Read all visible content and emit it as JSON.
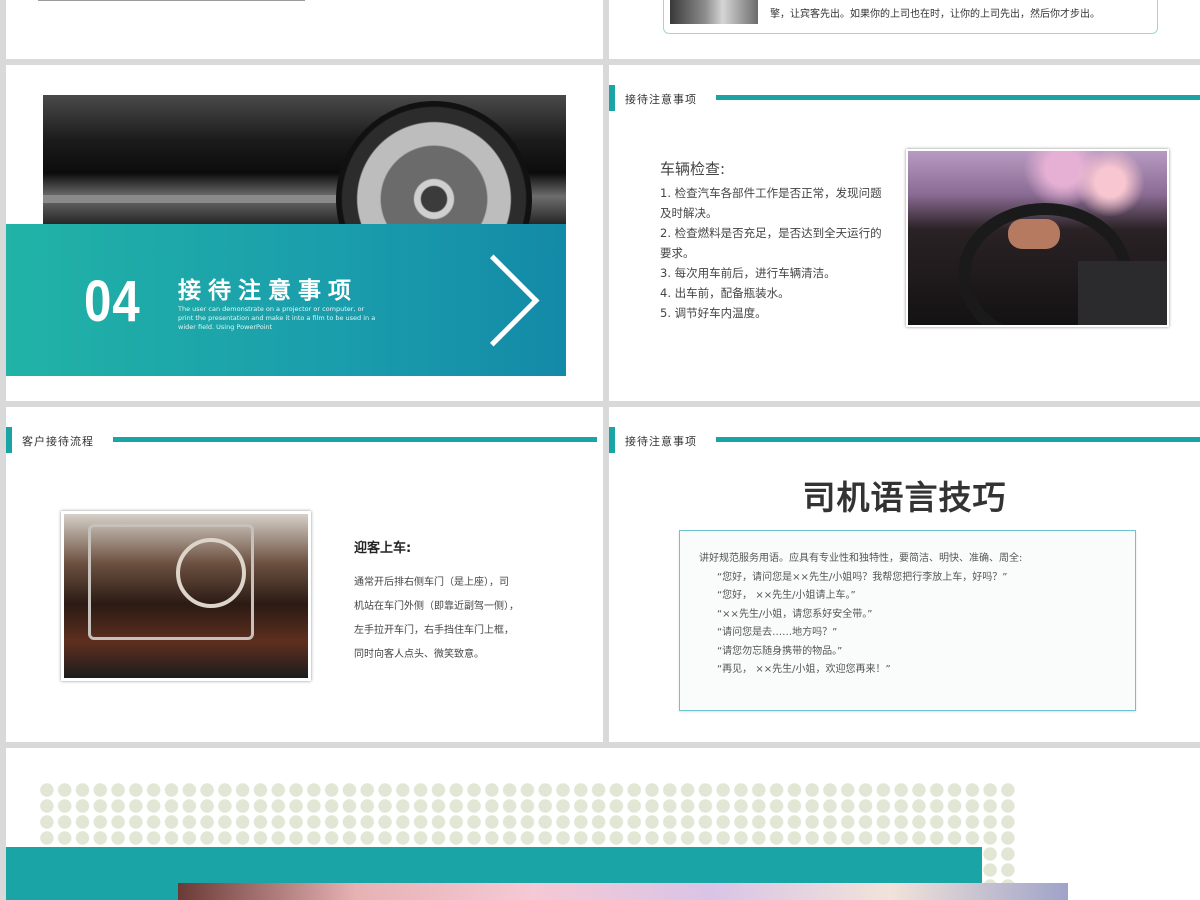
{
  "top_right_fragment": {
    "text": "擎，让宾客先出。如果你的上司也在时，让你的上司先出，然后你才步出。"
  },
  "section_intro": {
    "number": "04",
    "title": "接待注意事项",
    "subtitle": "The user can demonstrate on a projector or computer, or print the presentation and make it into a film to be used in a wider field. Using PowerPoint"
  },
  "vehicle_check": {
    "header": "接待注意事项",
    "title": "车辆检查:",
    "items": [
      "1. 检查汽车各部件工作是否正常，发现问题及时解决。",
      " 2. 检查燃料是否充足，是否达到全天运行的要求。",
      " 3. 每次用车前后，进行车辆清洁。",
      " 4. 出车前，配备瓶装水。",
      " 5. 调节好车内温度。"
    ]
  },
  "welcome": {
    "header": "客户接待流程",
    "title": "迎客上车:",
    "lines": [
      "通常开后排右侧车门（是上座），司",
      "机站在车门外侧（即靠近副驾一侧），",
      "左手拉开车门，右手挡住车门上框，",
      "同时向客人点头、微笑致意。"
    ]
  },
  "language": {
    "header": "接待注意事项",
    "title": "司机语言技巧",
    "intro": "讲好规范服务用语。应具有专业性和独特性，要简洁、明快、准确、周全:",
    "quotes": [
      "“您好，请问您是××先生/小姐吗？我帮您把行李放上车，好吗？”",
      "“您好，  ××先生/小姐请上车。”",
      "“××先生/小姐，请您系好安全带。”",
      "“请问您是去……地方吗？”",
      "“请您勿忘随身携带的物品。”",
      "“再见，  ××先生/小姐，欢迎您再来！”"
    ]
  },
  "colors": {
    "accent": "#1ba4a5",
    "background": "#d9d9d9",
    "dots": "#e2e6d4"
  }
}
